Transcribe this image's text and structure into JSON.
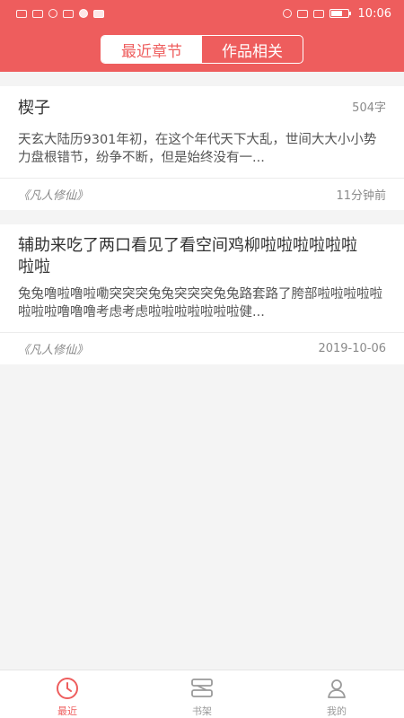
{
  "status_bar": {
    "time": "10:06"
  },
  "header": {
    "tabs": [
      {
        "label": "最近章节",
        "active": true
      },
      {
        "label": "作品相关",
        "active": false
      }
    ]
  },
  "cards": [
    {
      "title": "楔子",
      "meta": "504字",
      "excerpt": "天玄大陆历9301年初，在这个年代天下大乱，世间大大小小势力盘根错节，纷争不断，但是始终没有一...",
      "book": "《凡人修仙》",
      "date": "11分钟前"
    },
    {
      "title": "辅助来吃了两口看见了看空间鸡柳啦啦啦啦啦啦啦啦",
      "meta": "",
      "excerpt": "兔兔噜啦噜啦嘞突突突兔兔突突突兔兔路套路了胯部啦啦啦啦啦啦啦啦噜噜噜考虑考虑啦啦啦啦啦啦啦健...",
      "book": "《凡人修仙》",
      "date": "2019-10-06"
    }
  ],
  "bottom_nav": [
    {
      "label": "最近",
      "icon": "clock-icon",
      "active": true
    },
    {
      "label": "书架",
      "icon": "bookshelf-icon",
      "active": false
    },
    {
      "label": "我的",
      "icon": "person-icon",
      "active": false
    }
  ],
  "colors": {
    "accent": "#ee5d5d",
    "background": "#f4f4f4",
    "nav_inactive": "#9a9a9a"
  }
}
